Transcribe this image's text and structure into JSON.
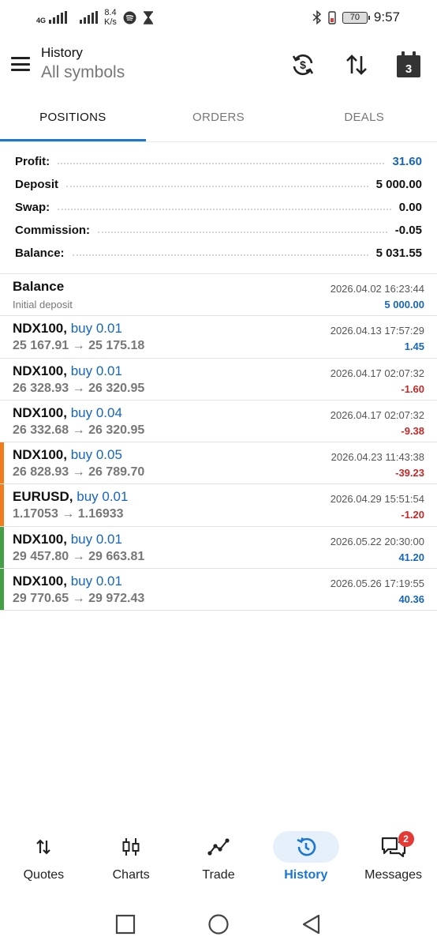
{
  "status_bar": {
    "network_type": "4G",
    "speed_value": "8.4",
    "speed_unit": "K/s",
    "battery": "70",
    "time": "9:57"
  },
  "header": {
    "title": "History",
    "subtitle": "All symbols",
    "calendar_number": "3"
  },
  "tabs": [
    {
      "label": "POSITIONS",
      "active": true
    },
    {
      "label": "ORDERS",
      "active": false
    },
    {
      "label": "DEALS",
      "active": false
    }
  ],
  "summary": {
    "profit_label": "Profit:",
    "profit_value": "31.60",
    "deposit_label": "Deposit",
    "deposit_value": "5 000.00",
    "swap_label": "Swap:",
    "swap_value": "0.00",
    "commission_label": "Commission:",
    "commission_value": "-0.05",
    "balance_label": "Balance:",
    "balance_value": "5 031.55"
  },
  "balance_entry": {
    "title": "Balance",
    "subtitle": "Initial deposit",
    "date": "2026.04.02 16:23:44",
    "amount": "5 000.00"
  },
  "positions": [
    {
      "symbol": "NDX100,",
      "side": "buy 0.01",
      "prices": "25 167.91 → 25 175.18",
      "date": "2026.04.13 17:57:29",
      "profit": "1.45",
      "sign": "pos",
      "bar": ""
    },
    {
      "symbol": "NDX100,",
      "side": "buy 0.01",
      "prices": "26 328.93 → 26 320.95",
      "date": "2026.04.17 02:07:32",
      "profit": "-1.60",
      "sign": "neg",
      "bar": ""
    },
    {
      "symbol": "NDX100,",
      "side": "buy 0.04",
      "prices": "26 332.68 → 26 320.95",
      "date": "2026.04.17 02:07:32",
      "profit": "-9.38",
      "sign": "neg",
      "bar": ""
    },
    {
      "symbol": "NDX100,",
      "side": "buy 0.05",
      "prices": "26 828.93 → 26 789.70",
      "date": "2026.04.23 11:43:38",
      "profit": "-39.23",
      "sign": "neg",
      "bar": "#f07c1e"
    },
    {
      "symbol": "EURUSD,",
      "side": "buy 0.01",
      "prices": "1.17053 → 1.16933",
      "date": "2026.04.29 15:51:54",
      "profit": "-1.20",
      "sign": "neg",
      "bar": "#f07c1e"
    },
    {
      "symbol": "NDX100,",
      "side": "buy 0.01",
      "prices": "29 457.80 → 29 663.81",
      "date": "2026.05.22 20:30:00",
      "profit": "41.20",
      "sign": "pos",
      "bar": "#43a047"
    },
    {
      "symbol": "NDX100,",
      "side": "buy 0.01",
      "prices": "29 770.65 → 29 972.43",
      "date": "2026.05.26 17:19:55",
      "profit": "40.36",
      "sign": "pos",
      "bar": "#43a047"
    }
  ],
  "bottom_nav": [
    {
      "label": "Quotes",
      "icon": "quotes-icon",
      "active": false
    },
    {
      "label": "Charts",
      "icon": "candlestick-icon",
      "active": false
    },
    {
      "label": "Trade",
      "icon": "trade-icon",
      "active": false
    },
    {
      "label": "History",
      "icon": "history-icon",
      "active": true
    },
    {
      "label": "Messages",
      "icon": "messages-icon",
      "active": false,
      "badge": "2"
    }
  ],
  "colors": {
    "accent": "#1976d2",
    "positive": "#1565c0",
    "negative": "#c62828",
    "bar_orange": "#f07c1e",
    "bar_green": "#43a047"
  }
}
